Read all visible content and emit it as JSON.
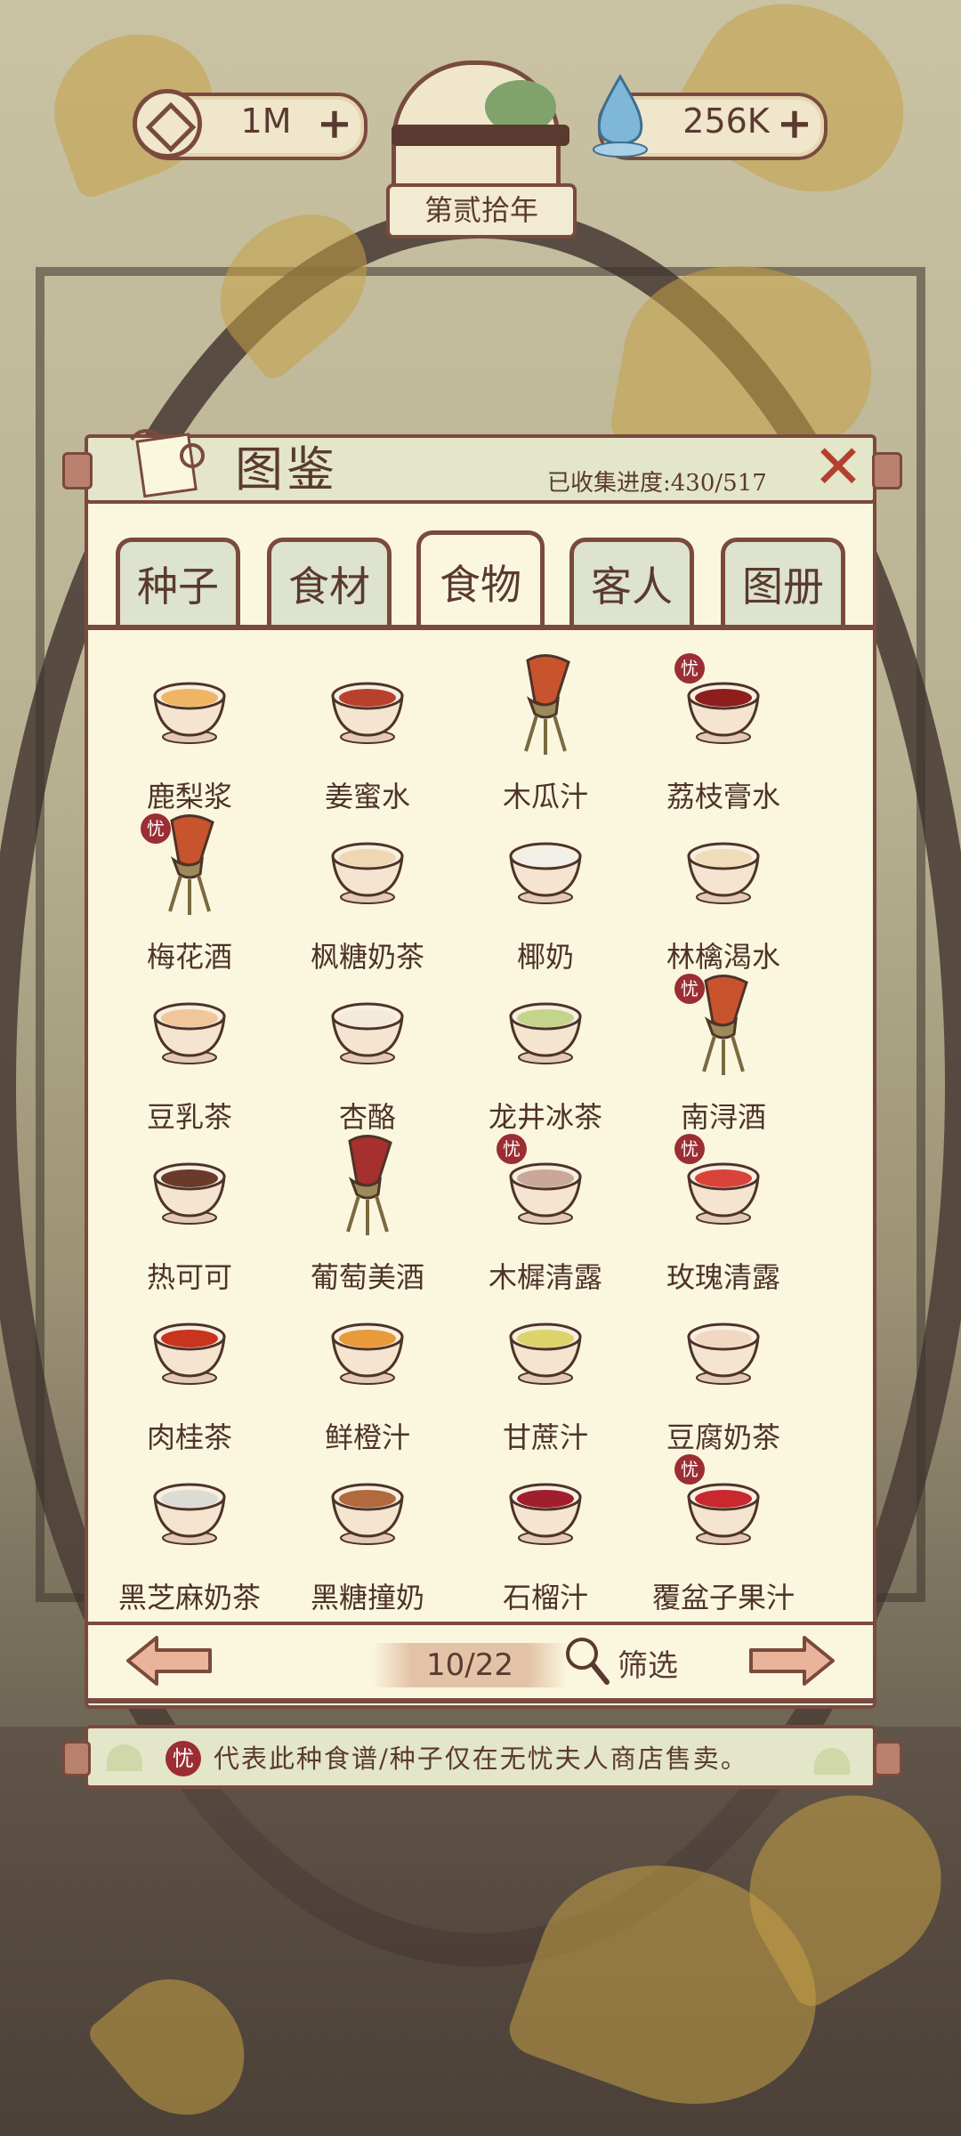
{
  "resources": {
    "coins": "1M",
    "jade": "256K"
  },
  "year_label": "第贰拾年",
  "panel": {
    "title": "图鉴",
    "progress": "已收集进度:430/517"
  },
  "tabs": [
    {
      "label": "种子",
      "active": false
    },
    {
      "label": "食材",
      "active": false
    },
    {
      "label": "食物",
      "active": true
    },
    {
      "label": "客人",
      "active": false
    },
    {
      "label": "图册",
      "active": false
    }
  ],
  "items": [
    {
      "name": "鹿梨浆",
      "icon": "cup-icon",
      "color": "#efb564",
      "exclusive": false
    },
    {
      "name": "姜蜜水",
      "icon": "cup-icon",
      "color": "#b8412e",
      "exclusive": false
    },
    {
      "name": "木瓜汁",
      "icon": "wine-vessel-icon",
      "color": "#c8542e",
      "exclusive": false
    },
    {
      "name": "荔枝膏水",
      "icon": "cup-icon",
      "color": "#8e1e1e",
      "exclusive": true
    },
    {
      "name": "梅花酒",
      "icon": "wine-vessel-icon",
      "color": "#c8542e",
      "exclusive": true
    },
    {
      "name": "枫糖奶茶",
      "icon": "cup-icon",
      "color": "#eed8b4",
      "exclusive": false
    },
    {
      "name": "椰奶",
      "icon": "cup-icon",
      "color": "#f2efe8",
      "exclusive": false
    },
    {
      "name": "林檎渴水",
      "icon": "cup-icon",
      "color": "#efdcb8",
      "exclusive": false
    },
    {
      "name": "豆乳茶",
      "icon": "cup-icon",
      "color": "#f0c79a",
      "exclusive": false
    },
    {
      "name": "杏酪",
      "icon": "cup-icon",
      "color": "#f4eadc",
      "exclusive": false
    },
    {
      "name": "龙井冰茶",
      "icon": "cup-icon",
      "color": "#c5d48c",
      "exclusive": false
    },
    {
      "name": "南浔酒",
      "icon": "wine-vessel-icon",
      "color": "#c8542e",
      "exclusive": true
    },
    {
      "name": "热可可",
      "icon": "cup-icon",
      "color": "#6a3a2a",
      "exclusive": false
    },
    {
      "name": "葡萄美酒",
      "icon": "wine-vessel-icon",
      "color": "#a5302e",
      "exclusive": false
    },
    {
      "name": "木樨清露",
      "icon": "cup-icon",
      "color": "#c9a89a",
      "exclusive": true
    },
    {
      "name": "玫瑰清露",
      "icon": "cup-icon",
      "color": "#d9433a",
      "exclusive": true
    },
    {
      "name": "肉桂茶",
      "icon": "cup-icon",
      "color": "#c8341e",
      "exclusive": false
    },
    {
      "name": "鲜橙汁",
      "icon": "cup-icon",
      "color": "#e99a3a",
      "exclusive": false
    },
    {
      "name": "甘蔗汁",
      "icon": "cup-icon",
      "color": "#dcd46a",
      "exclusive": false
    },
    {
      "name": "豆腐奶茶",
      "icon": "cup-icon",
      "color": "#f0d8c2",
      "exclusive": false
    },
    {
      "name": "黑芝麻奶茶",
      "icon": "cup-icon",
      "color": "#dcdcd4",
      "exclusive": false
    },
    {
      "name": "黑糖撞奶",
      "icon": "cup-icon",
      "color": "#b06a3e",
      "exclusive": false
    },
    {
      "name": "石榴汁",
      "icon": "cup-icon",
      "color": "#a01e2e",
      "exclusive": false
    },
    {
      "name": "覆盆子果汁",
      "icon": "cup-icon",
      "color": "#c8282e",
      "exclusive": true
    }
  ],
  "exclusive_badge": "忧",
  "pagination": {
    "page": "10/22",
    "filter_label": "筛选"
  },
  "note": {
    "badge": "忧",
    "text": "代表此种食谱/种子仅在无忧夫人商店售卖。"
  }
}
